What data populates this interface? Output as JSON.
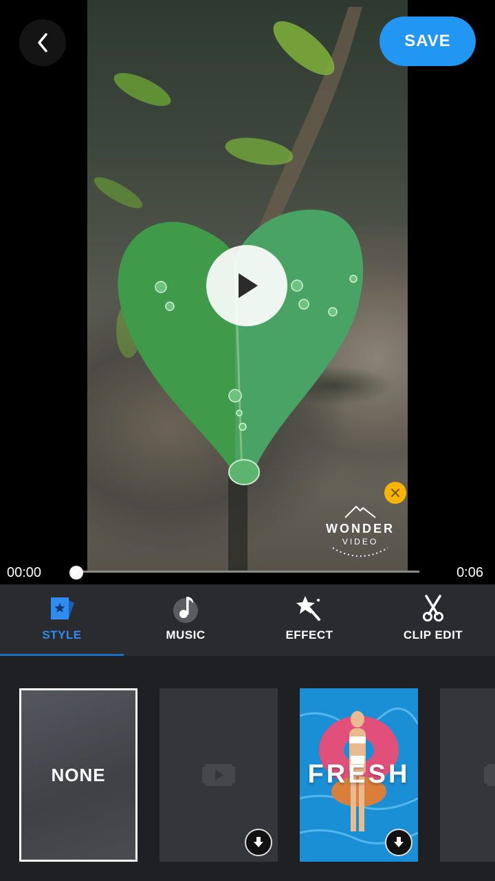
{
  "header": {
    "back_icon": "chevron-left-icon",
    "save_label": "SAVE"
  },
  "player": {
    "play_icon": "play-icon",
    "current_time": "00:00",
    "total_time": "0:06",
    "progress": 0
  },
  "watermark": {
    "title": "WONDER",
    "subtitle": "VIDEO",
    "close_icon": "close-icon"
  },
  "tabs": [
    {
      "label": "STYLE",
      "icon": "style-icon",
      "active": true
    },
    {
      "label": "MUSIC",
      "icon": "music-note-icon",
      "active": false
    },
    {
      "label": "EFFECT",
      "icon": "magic-wand-icon",
      "active": false
    },
    {
      "label": "CLIP EDIT",
      "icon": "scissors-icon",
      "active": false
    }
  ],
  "styles": [
    {
      "label": "NONE",
      "selected": true
    },
    {
      "label": "",
      "downloadable": true
    },
    {
      "label": "FRESH",
      "downloadable": true
    }
  ],
  "colors": {
    "accent": "#2196f3",
    "tab_active": "#2f8cf0",
    "watermark_close": "#f7b500"
  }
}
